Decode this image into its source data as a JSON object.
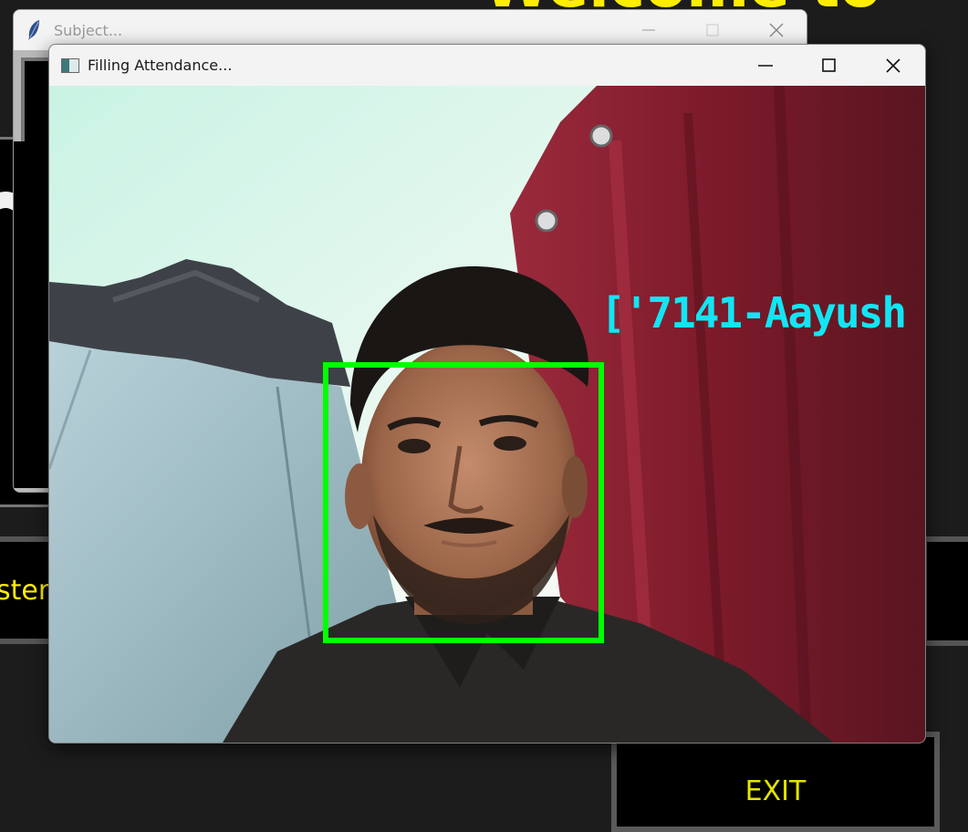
{
  "background_app": {
    "header_text": "Welcome to",
    "register_button_label": "ster",
    "exit_button_label": "EXIT"
  },
  "back_window": {
    "title": "Subject..."
  },
  "front_window": {
    "title": "Filling Attendance...",
    "face_label": "['7141-Aayush"
  },
  "colors": {
    "face_box": "#00ff00",
    "face_label": "#11e6f4",
    "accent_yellow": "#ffee00"
  }
}
